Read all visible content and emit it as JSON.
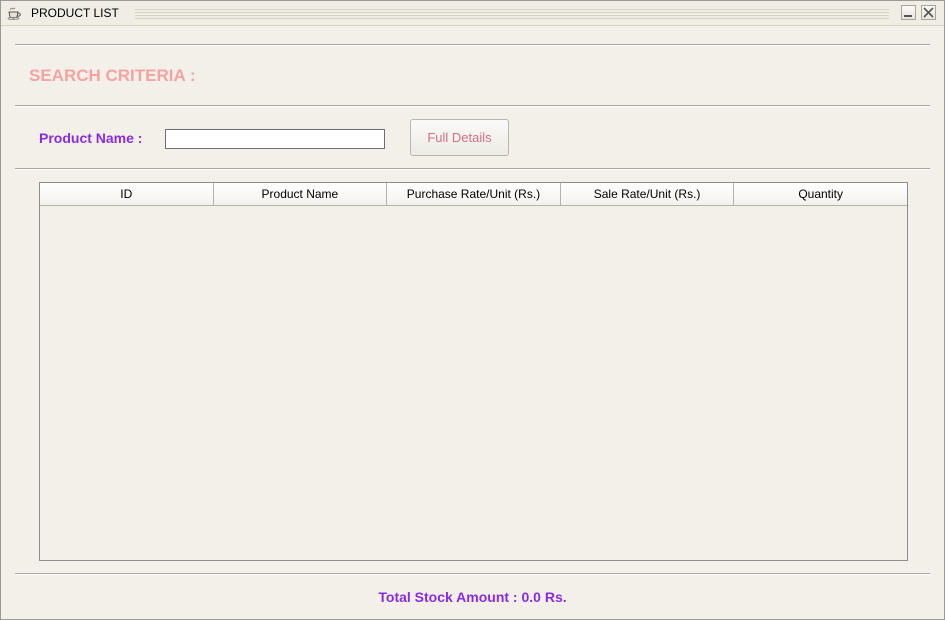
{
  "window": {
    "title": "PRODUCT LIST",
    "app_icon": "coffee-cup-icon",
    "buttons": [
      "minimize-icon",
      "close-icon"
    ]
  },
  "search": {
    "heading": "SEARCH CRITERIA :",
    "product_name_label": "Product Name :",
    "product_name_value": "",
    "full_details_label": "Full Details"
  },
  "table": {
    "columns": [
      "ID",
      "Product Name",
      "Purchase Rate/Unit (Rs.)",
      "Sale Rate/Unit (Rs.)",
      "Quantity"
    ],
    "rows": []
  },
  "footer": {
    "total_label": "Total Stock Amount : 0.0 Rs."
  },
  "colors": {
    "heading": "#f4a3a2",
    "label": "#8a2be2",
    "button_text": "#d0708a",
    "background": "#f3f0e9"
  }
}
